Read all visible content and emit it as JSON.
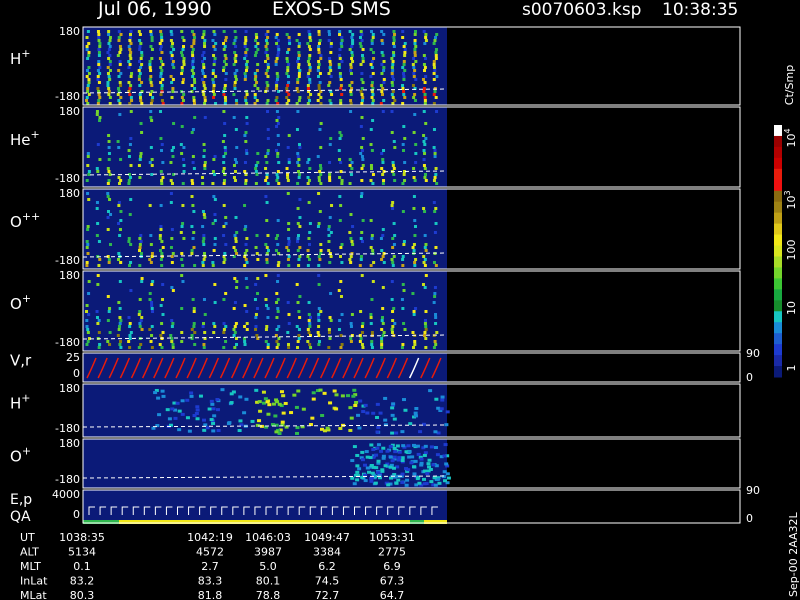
{
  "header": {
    "date": "Jul 06, 1990",
    "instrument": "EXOS-D SMS",
    "file": "s0070603.ksp",
    "time": "10:38:35"
  },
  "chart_data": {
    "type": "heatmap",
    "panels": [
      {
        "id": "h-plus",
        "label": "H",
        "sup": "+",
        "ymax": "180",
        "ymin": "-180"
      },
      {
        "id": "he-plus",
        "label": "He",
        "sup": "+",
        "ymax": "180",
        "ymin": "-180"
      },
      {
        "id": "o-plusplus",
        "label": "O",
        "sup": "++",
        "ymax": "180",
        "ymin": "-180"
      },
      {
        "id": "o-plus",
        "label": "O",
        "sup": "+",
        "ymax": "180",
        "ymin": "-180"
      },
      {
        "id": "vr",
        "label": "V,r",
        "sup": "",
        "ymax": "25",
        "ymin": "0",
        "right_top": "90",
        "right_bottom": "0"
      },
      {
        "id": "h-plus-2",
        "label": "H",
        "sup": "+",
        "ymax": "180",
        "ymin": "-180"
      },
      {
        "id": "o-plus-2",
        "label": "O",
        "sup": "+",
        "ymax": "180",
        "ymin": "-180"
      },
      {
        "id": "ep-qa",
        "label": "E,p",
        "label2": "QA",
        "sup": "",
        "ymax": "4000",
        "ymin": "0",
        "right_top": "90",
        "right_bottom": "0"
      }
    ],
    "colorbar": {
      "title": "Ct/Smp",
      "ticks": [
        {
          "label": "10",
          "sup": "4"
        },
        {
          "label": "10",
          "sup": "3"
        },
        {
          "label": "100",
          "sup": ""
        },
        {
          "label": "10",
          "sup": ""
        },
        {
          "label": "1",
          "sup": ""
        }
      ]
    },
    "footer": "Sep-00 2AA32L",
    "ephemeris": {
      "rows": [
        {
          "label": "UT",
          "values": [
            "1038:35",
            "1042:19",
            "1046:03",
            "1049:47",
            "1053:31"
          ]
        },
        {
          "label": "ALT",
          "values": [
            "5134",
            "4572",
            "3987",
            "3384",
            "2775"
          ]
        },
        {
          "label": "MLT",
          "values": [
            "0.1",
            "2.7",
            "5.0",
            "6.2",
            "6.9"
          ]
        },
        {
          "label": "InLat",
          "values": [
            "83.2",
            "83.3",
            "80.1",
            "74.5",
            "67.3"
          ]
        },
        {
          "label": "MLat",
          "values": [
            "80.3",
            "81.8",
            "78.8",
            "72.7",
            "64.7"
          ]
        }
      ]
    }
  }
}
